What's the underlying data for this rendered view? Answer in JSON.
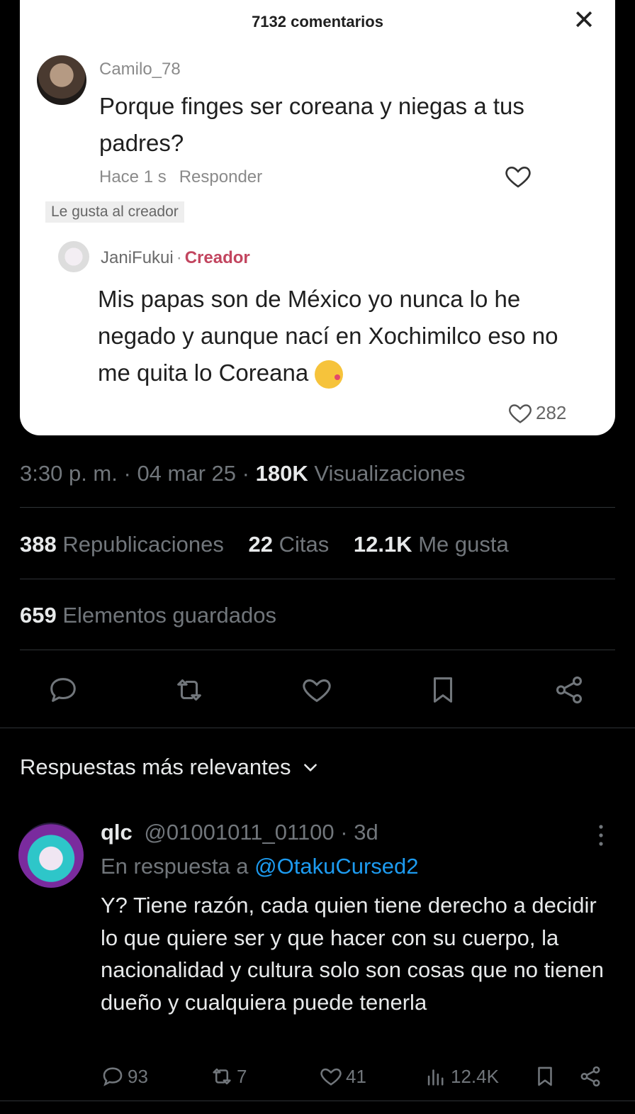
{
  "embedded_screenshot": {
    "header": "7132 comentarios",
    "close_glyph": "✕",
    "comment": {
      "username": "Camilo_78",
      "text": "Porque finges ser coreana y niegas a tus padres?",
      "time": "Hace 1 s",
      "reply_label": "Responder"
    },
    "liked_by_creator": "Le gusta al creador",
    "reply": {
      "username": "JaniFukui",
      "separator": "·",
      "badge": "Creador",
      "text": "Mis papas son de México yo nunca lo he negado y aunque nací en Xochimilco eso no me quita lo Coreana",
      "likes": "282"
    }
  },
  "tweet_meta": {
    "time": "3:30 p. m.",
    "date": "04 mar 25",
    "views_count": "180K",
    "views_label": "Visualizaciones",
    "sep": "·"
  },
  "stats": {
    "reposts_count": "388",
    "reposts_label": "Republicaciones",
    "quotes_count": "22",
    "quotes_label": "Citas",
    "likes_count": "12.1K",
    "likes_label": "Me gusta",
    "bookmarks_count": "659",
    "bookmarks_label": "Elementos guardados"
  },
  "sort": {
    "label": "Respuestas más relevantes"
  },
  "reply_tweet": {
    "display_name": "qlc",
    "handle": "@01001011_01100",
    "sep": "·",
    "age": "3d",
    "in_reply_prefix": "En respuesta a",
    "in_reply_handle": "@OtakuCursed2",
    "text": "Y? Tiene razón, cada quien tiene derecho a decidir lo que quiere ser y que hacer con su cuerpo, la nacionalidad y cultura solo son cosas que no tienen dueño y cualquiera puede tenerla",
    "replies": "93",
    "reposts": "7",
    "likes": "41",
    "views": "12.4K"
  },
  "colors": {
    "background": "#000000",
    "text_primary": "#e7e9ea",
    "text_secondary": "#71767b",
    "link": "#1d9bf0",
    "divider": "#2f3336",
    "creator_badge": "#c2455f"
  },
  "icons": [
    "close-icon",
    "heart-icon",
    "reply-icon",
    "repost-icon",
    "bookmark-icon",
    "share-icon",
    "chevron-down-icon",
    "more-icon",
    "views-icon"
  ]
}
